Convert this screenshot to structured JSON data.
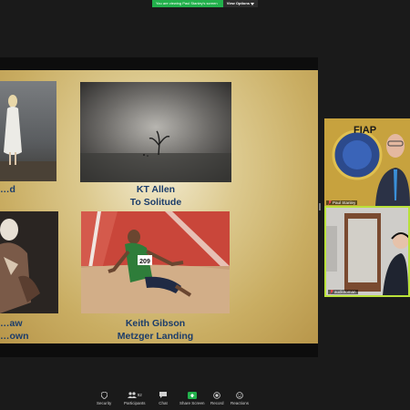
{
  "banner": {
    "message": "You are viewing Paul Stanley's screen",
    "options_label": "View Options",
    "options_icon": "chevron-down-icon"
  },
  "slide": {
    "entries": [
      {
        "photographer": "…d",
        "title": ""
      },
      {
        "photographer": "KT Allen",
        "title": "To Solitude"
      },
      {
        "photographer": "…aw",
        "title": "…own"
      },
      {
        "photographer": "Keith Gibson",
        "title": "Metzger Landing"
      }
    ],
    "bib_number": "209",
    "caption_color": "#1b3c6a"
  },
  "participants": [
    {
      "name": "Paul Stanley",
      "mic_icon": "mic-muted-icon",
      "logo_text": "FIAP"
    },
    {
      "name": "audiotoman",
      "mic_icon": "mic-muted-icon",
      "active_speaker": true,
      "active_color": "#b9e13a"
    }
  ],
  "toolbar": {
    "buttons": [
      {
        "label": "Security",
        "icon": "shield-icon"
      },
      {
        "label": "Participants",
        "icon": "participants-icon",
        "count": "92"
      },
      {
        "label": "Chat",
        "icon": "chat-icon"
      },
      {
        "label": "Share Screen",
        "icon": "share-screen-icon",
        "accent": "#22b14c"
      },
      {
        "label": "Record",
        "icon": "record-icon"
      },
      {
        "label": "Reactions",
        "icon": "reactions-icon"
      }
    ]
  }
}
